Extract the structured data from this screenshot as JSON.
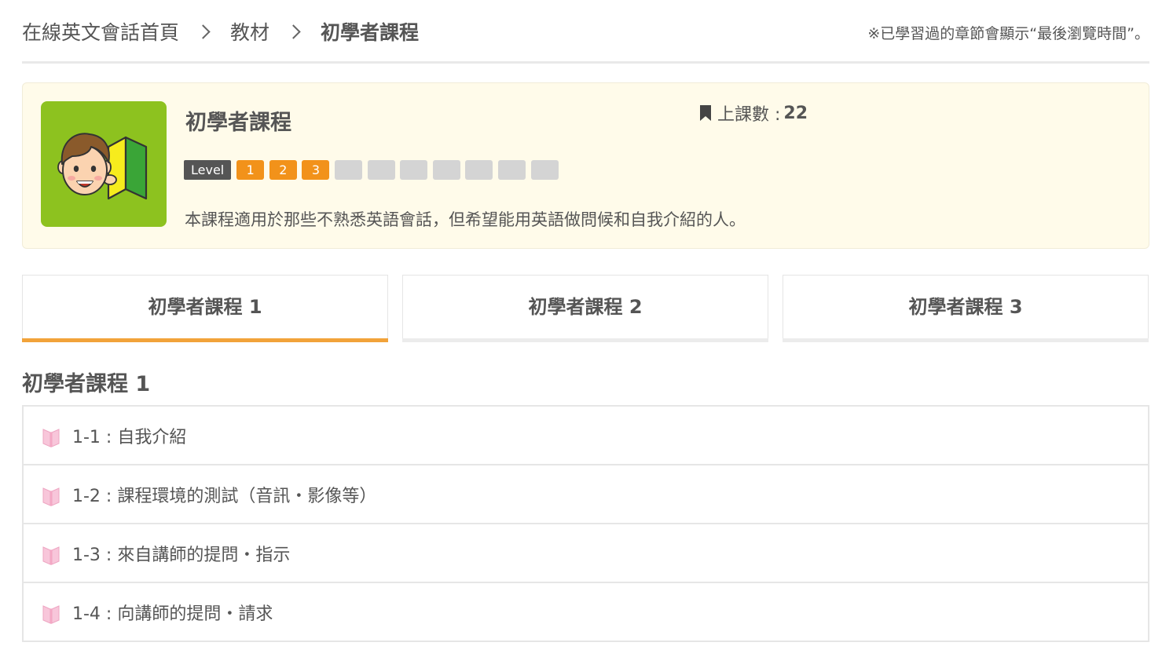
{
  "breadcrumb": {
    "home": "在線英文會話首頁",
    "materials": "教材",
    "current": "初學者課程"
  },
  "note": "※已學習過的章節會顯示“最後瀏覽時間”。",
  "course": {
    "title": "初學者課程",
    "lesson_count_label": "上課數 :",
    "lesson_count": "22",
    "level_label": "Level",
    "levels": [
      "1",
      "2",
      "3",
      "",
      "",
      "",
      "",
      "",
      "",
      ""
    ],
    "levels_active": 3,
    "description": "本課程適用於那些不熟悉英語會話，但希望能用英語做問候和自我介紹的人。"
  },
  "tabs": [
    {
      "label": "初學者課程 1",
      "active": true
    },
    {
      "label": "初學者課程 2",
      "active": false
    },
    {
      "label": "初學者課程 3",
      "active": false
    }
  ],
  "section_title": "初學者課程 1",
  "chapters": [
    {
      "label": "1-1 : 自我介紹"
    },
    {
      "label": "1-2 : 課程環境的測試（音訊・影像等）"
    },
    {
      "label": "1-3 : 來自講師的提問・指示"
    },
    {
      "label": "1-4 : 向講師的提問・請求"
    }
  ],
  "colors": {
    "accent": "#f2a33a",
    "level_on": "#f2921a",
    "level_off": "#d4d4d4",
    "thumb_bg": "#8dc21f",
    "card_bg": "#fffbea",
    "book_icon": "#f6b6cf"
  },
  "icons": {
    "breadcrumb_separator": "chevron-right-icon",
    "lesson_count": "bookmark-icon",
    "chapter": "book-icon",
    "thumbnail": "beginner-mark-boy-illustration"
  }
}
